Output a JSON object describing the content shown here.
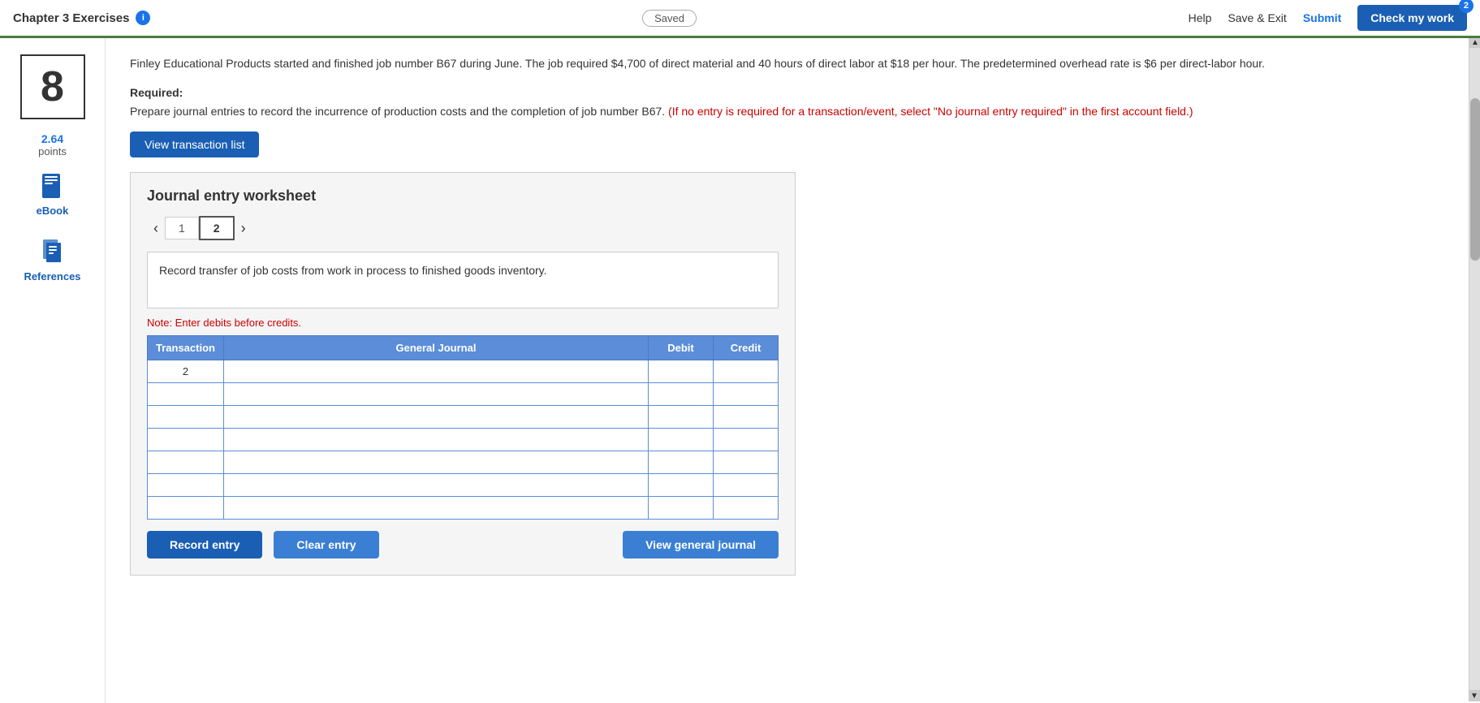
{
  "header": {
    "title": "Chapter 3 Exercises",
    "info_icon": "i",
    "saved_label": "Saved",
    "help_label": "Help",
    "save_exit_label": "Save & Exit",
    "submit_label": "Submit",
    "check_work_label": "Check my work",
    "check_work_badge": "2"
  },
  "sidebar": {
    "question_number": "8",
    "points_value": "2.64",
    "points_label": "points",
    "ebook_label": "eBook",
    "references_label": "References"
  },
  "problem": {
    "text": "Finley Educational Products started and finished job number B67 during June. The job required $4,700 of direct material and 40 hours of direct labor at $18 per hour. The predetermined overhead rate is $6 per direct-labor hour.",
    "required_label": "Required:",
    "required_text": "Prepare journal entries to record the incurrence of production costs and the completion of job number B67.",
    "red_text": "(If no entry is required for a transaction/event, select \"No journal entry required\" in the first account field.)"
  },
  "view_transaction_btn": "View transaction list",
  "worksheet": {
    "title": "Journal entry worksheet",
    "tab_prev_label": "‹",
    "tab_next_label": "›",
    "tabs": [
      {
        "label": "1",
        "active": false
      },
      {
        "label": "2",
        "active": true
      }
    ],
    "description": "Record transfer of job costs from work in process to finished goods inventory.",
    "note": "Note: Enter debits before credits.",
    "table": {
      "headers": [
        "Transaction",
        "General Journal",
        "Debit",
        "Credit"
      ],
      "rows": [
        {
          "transaction": "2",
          "general_journal": "",
          "debit": "",
          "credit": ""
        },
        {
          "transaction": "",
          "general_journal": "",
          "debit": "",
          "credit": ""
        },
        {
          "transaction": "",
          "general_journal": "",
          "debit": "",
          "credit": ""
        },
        {
          "transaction": "",
          "general_journal": "",
          "debit": "",
          "credit": ""
        },
        {
          "transaction": "",
          "general_journal": "",
          "debit": "",
          "credit": ""
        },
        {
          "transaction": "",
          "general_journal": "",
          "debit": "",
          "credit": ""
        },
        {
          "transaction": "",
          "general_journal": "",
          "debit": "",
          "credit": ""
        }
      ]
    },
    "record_entry_label": "Record entry",
    "clear_entry_label": "Clear entry",
    "view_general_journal_label": "View general journal"
  }
}
